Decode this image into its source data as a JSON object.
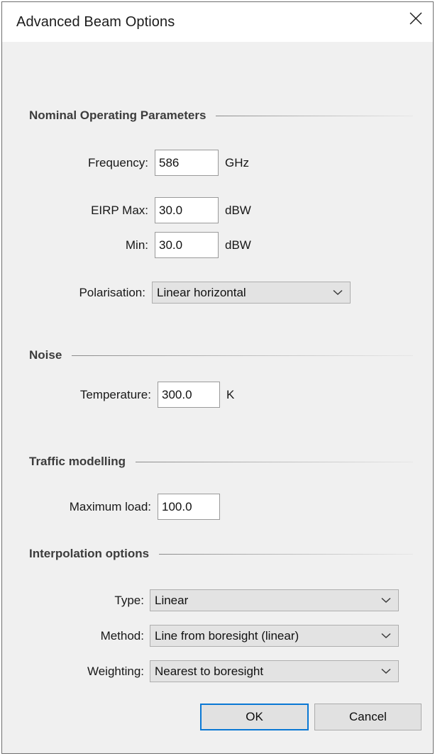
{
  "window": {
    "title": "Advanced Beam Options",
    "close_icon": "close-icon"
  },
  "sections": {
    "nominal": {
      "heading": "Nominal Operating Parameters",
      "fields": {
        "frequency": {
          "label": "Frequency:",
          "value": "586",
          "unit": "GHz"
        },
        "eirp_max": {
          "label": "EIRP Max:",
          "value": "30.0",
          "unit": "dBW"
        },
        "eirp_min": {
          "label": "Min:",
          "value": "30.0",
          "unit": "dBW"
        },
        "polarisation": {
          "label": "Polarisation:",
          "value": "Linear horizontal",
          "chevron_icon": "chevron-down-icon"
        }
      }
    },
    "noise": {
      "heading": "Noise",
      "fields": {
        "temperature": {
          "label": "Temperature:",
          "value": "300.0",
          "unit": "K"
        }
      }
    },
    "traffic": {
      "heading": "Traffic modelling",
      "fields": {
        "max_load": {
          "label": "Maximum load:",
          "value": "100.0",
          "unit": ""
        }
      }
    },
    "interpolation": {
      "heading": "Interpolation options",
      "fields": {
        "type": {
          "label": "Type:",
          "value": "Linear",
          "chevron_icon": "chevron-down-icon"
        },
        "method": {
          "label": "Method:",
          "value": "Line from boresight (linear)",
          "chevron_icon": "chevron-down-icon"
        },
        "weighting": {
          "label": "Weighting:",
          "value": "Nearest to boresight",
          "chevron_icon": "chevron-down-icon"
        }
      }
    }
  },
  "footer": {
    "ok_label": "OK",
    "cancel_label": "Cancel"
  },
  "colors": {
    "accent_focus": "#0a78d4",
    "dialog_background": "#f0f0f0",
    "titlebar_background": "#ffffff",
    "heading_text": "#3c3c3c",
    "field_background": "#ffffff",
    "combo_background": "#e3e3e3"
  }
}
